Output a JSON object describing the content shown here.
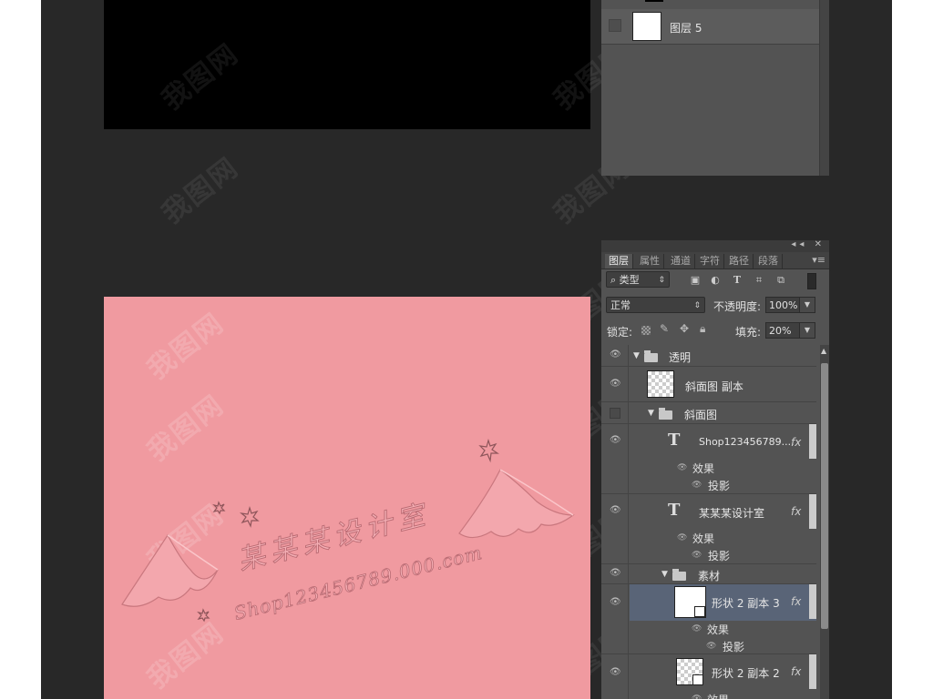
{
  "watermark": "我图网",
  "upper_panel": {
    "layer": {
      "name": "图层 5"
    }
  },
  "layers_panel": {
    "tabs": [
      "图层",
      "属性",
      "通道",
      "字符",
      "路径",
      "段落"
    ],
    "filter_kind": "类型",
    "blend_mode": "正常",
    "opacity_label": "不透明度:",
    "opacity_value": "100%",
    "lock_label": "锁定:",
    "fill_label": "填充:",
    "fill_value": "20%",
    "layers": [
      {
        "name": "透明"
      },
      {
        "name": "斜面图 副本"
      },
      {
        "name": "斜面图"
      },
      {
        "name": "Shop123456789....",
        "effects": "效果",
        "shadow": "投影"
      },
      {
        "name": "某某某设计室",
        "effects": "效果",
        "shadow": "投影"
      },
      {
        "name": "素材"
      },
      {
        "name": "形状 2 副本 3",
        "effects": "效果",
        "shadow": "投影"
      },
      {
        "name": "形状 2 副本 2",
        "effects": "效果"
      }
    ]
  },
  "canvas": {
    "title_text": "某某某设计室",
    "url_text": "Shop123456789.000.com"
  }
}
